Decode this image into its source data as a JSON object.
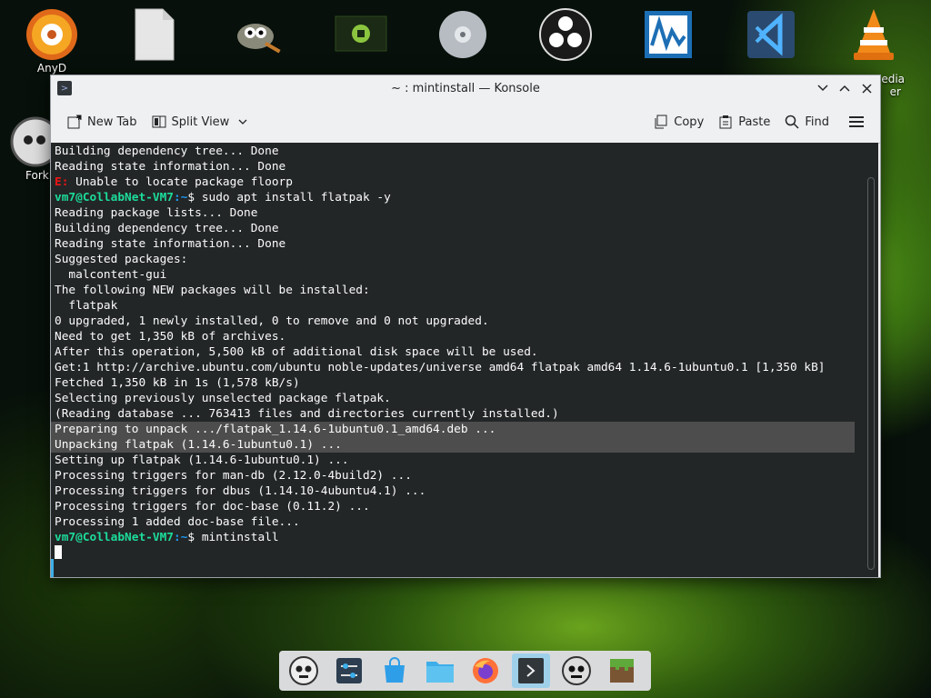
{
  "desktop": {
    "icons_top": [
      {
        "icon": "anydesk-disc-icon",
        "caption": "AnyD"
      },
      {
        "icon": "blank-file-icon",
        "caption": ""
      },
      {
        "icon": "gimp-icon",
        "caption": ""
      },
      {
        "icon": "linux-mint-icon",
        "caption": ""
      },
      {
        "icon": "disc-drive-icon",
        "caption": ""
      },
      {
        "icon": "obs-studio-icon",
        "caption": ""
      },
      {
        "icon": "system-monitor-icon",
        "caption": ""
      },
      {
        "icon": "vscode-icon",
        "caption": ""
      },
      {
        "icon": "vlc-icon",
        "caption": "edia"
      }
    ],
    "icons_left": [
      {
        "icon": "forkbomb-skull-icon",
        "caption": "Fork"
      }
    ],
    "vlc_caption_line2": "er"
  },
  "window": {
    "title": "~ : mintinstall — Konsole",
    "toolbar": {
      "new_tab": "New Tab",
      "split_view": "Split View",
      "copy": "Copy",
      "paste": "Paste",
      "find": "Find"
    }
  },
  "terminal": {
    "prompt_user": "vm7@CollabNet-VM7",
    "prompt_path": ":~",
    "lines": [
      {
        "type": "text",
        "text": "Building dependency tree... Done"
      },
      {
        "type": "text",
        "text": "Reading state information... Done"
      },
      {
        "type": "error",
        "prefix": "E:",
        "text": " Unable to locate package floorp"
      },
      {
        "type": "prompt",
        "cmd": "$ sudo apt install flatpak -y"
      },
      {
        "type": "text",
        "text": "Reading package lists... Done"
      },
      {
        "type": "text",
        "text": "Building dependency tree... Done"
      },
      {
        "type": "text",
        "text": "Reading state information... Done"
      },
      {
        "type": "text",
        "text": "Suggested packages:"
      },
      {
        "type": "text",
        "text": "  malcontent-gui"
      },
      {
        "type": "text",
        "text": "The following NEW packages will be installed:"
      },
      {
        "type": "text",
        "text": "  flatpak"
      },
      {
        "type": "text",
        "text": "0 upgraded, 1 newly installed, 0 to remove and 0 not upgraded."
      },
      {
        "type": "text",
        "text": "Need to get 1,350 kB of archives."
      },
      {
        "type": "text",
        "text": "After this operation, 5,500 kB of additional disk space will be used."
      },
      {
        "type": "text",
        "text": "Get:1 http://archive.ubuntu.com/ubuntu noble-updates/universe amd64 flatpak amd64 1.14.6-1ubuntu0.1 [1,350 kB]"
      },
      {
        "type": "text",
        "text": "Fetched 1,350 kB in 1s (1,578 kB/s)"
      },
      {
        "type": "text",
        "text": "Selecting previously unselected package flatpak."
      },
      {
        "type": "text",
        "text": "(Reading database ... 763413 files and directories currently installed.)"
      },
      {
        "type": "selected",
        "text": "Preparing to unpack .../flatpak_1.14.6-1ubuntu0.1_amd64.deb ..."
      },
      {
        "type": "selected",
        "text": "Unpacking flatpak (1.14.6-1ubuntu0.1) ..."
      },
      {
        "type": "text",
        "text": "Setting up flatpak (1.14.6-1ubuntu0.1) ..."
      },
      {
        "type": "text",
        "text": "Processing triggers for man-db (2.12.0-4build2) ..."
      },
      {
        "type": "text",
        "text": "Processing triggers for dbus (1.14.10-4ubuntu4.1) ..."
      },
      {
        "type": "text",
        "text": "Processing triggers for doc-base (0.11.2) ..."
      },
      {
        "type": "text",
        "text": "Processing 1 added doc-base file..."
      },
      {
        "type": "prompt",
        "cmd": "$ mintinstall"
      }
    ]
  },
  "taskbar": {
    "items": [
      {
        "icon": "forkbomb-skull-icon",
        "active": false
      },
      {
        "icon": "system-settings-icon",
        "active": false
      },
      {
        "icon": "software-store-icon",
        "active": false
      },
      {
        "icon": "file-manager-icon",
        "active": false
      },
      {
        "icon": "firefox-icon",
        "active": false
      },
      {
        "icon": "konsole-icon",
        "active": true
      },
      {
        "icon": "skull-app-icon",
        "active": false
      },
      {
        "icon": "minecraft-icon",
        "active": false
      }
    ]
  },
  "colors": {
    "terminal_bg": "#232627",
    "prompt_green": "#1cdc9a",
    "prompt_blue": "#1d99f3",
    "error_red": "#ed1515",
    "selection": "#4d4d4d",
    "taskbar_active": "#9fd0ea"
  }
}
